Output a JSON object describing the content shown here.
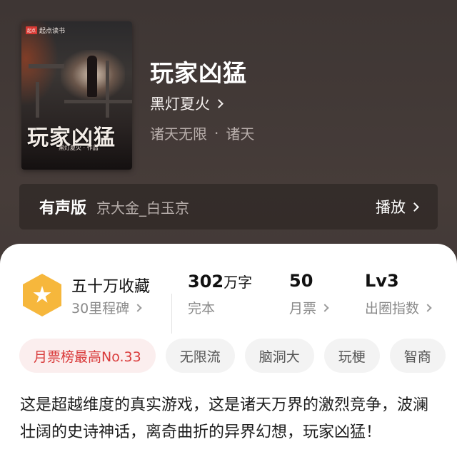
{
  "book": {
    "title": "玩家凶猛",
    "author": "黑灯夏火",
    "genre": "诸天无限",
    "genre_sub": "诸天",
    "separator": "·"
  },
  "cover": {
    "brand": "起点读书",
    "brand_logo": "起点",
    "title_text": "玩家凶猛",
    "author_text": "黑灯夏火 · 作品"
  },
  "audio": {
    "label": "有声版",
    "narrator": "京大金_白玉京",
    "play_label": "播放"
  },
  "stats": {
    "collection_title": "五十万收藏",
    "collection_sub": "30里程碑",
    "words_value": "302",
    "words_unit": "万字",
    "words_status": "完本",
    "monthly_value": "50",
    "monthly_label": "月票",
    "level_value": "Lv3",
    "level_label": "出圈指数"
  },
  "tags": [
    "月票榜最高No.33",
    "无限流",
    "脑洞大",
    "玩梗",
    "智商"
  ],
  "intro": "这是超越维度的真实游戏，这是诸天万界的激烈竞争，波澜壮阔的史诗神话，离奇曲折的异界幻想，玩家凶猛！",
  "colors": {
    "accent_red": "#d93a3a",
    "badge_gold": "#f6b73c",
    "hero_bg": "#463c39"
  }
}
